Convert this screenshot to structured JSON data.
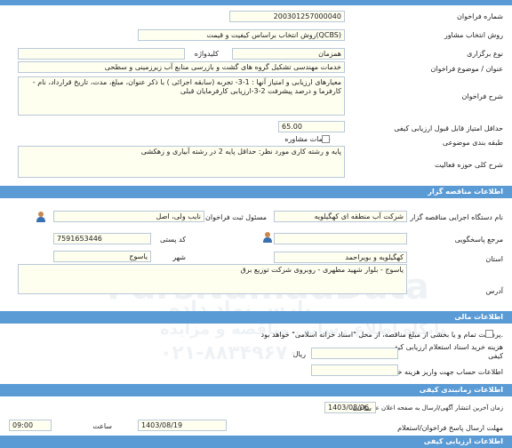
{
  "sections": {
    "tender": "",
    "organizer": "اطلاعات مناقصه گزار",
    "financial": "اطلاعات مالی",
    "timing": "اطلاعات زمانبندی کیفی",
    "quality": "اطلاعات ارزیابی کیفی"
  },
  "tender": {
    "number_label": "شماره فراخوان",
    "number": "200301257000040",
    "method_label": "روش انتخاب مشاور",
    "method": "روش انتخاب براساس کیفیت و قیمت(QCBS)",
    "type_label": "نوع برگزاری",
    "type": "همزمان",
    "keyword_label": "کلیدواژه",
    "keyword": "",
    "subject_label": "عنوان / موضوع فراخوان",
    "subject": "خدمات مهندسی تشکیل گروه های گشت و بازرسی منابع آب زیرزمینی و سطحی",
    "description_label": "شرح فراخوان",
    "description": "- معیارهای ارزیابی و امتیاز آنها : 1-3- تجربه (سابقه اجرائی ) با ذکر عنوان، مبلغ، مدت، تاریخ قرارداد، نام کارفرما و درصد پیشرفت 2-3-ارزیابی کارفرمایان قبلی",
    "min_score_label": "حداقل امتیاز قابل قبول ارزیابی کیفی",
    "min_score": "65.00",
    "category_label": "طبقه بندی موضوعی",
    "category_option": "خدمات مشاوره",
    "activity_label": "شرح کلی حوزه فعالیت",
    "activity": "پایه و رشته کاری مورد نظر: حداقل پایه 2 در رشته آبیاری و زهکشی"
  },
  "organizer": {
    "executor_label": "نام دستگاه اجرایی مناقصه گزار",
    "executor": "شرکت آب منطقه ای کهگیلویه",
    "registrar_label": "مسئول ثبت فراخوان",
    "registrar": "نایب ولی، اصل",
    "reference_label": "مرجع پاسخگویی",
    "reference": "",
    "postal_label": "کد پستی",
    "postal": "7591653446",
    "province_label": "استان",
    "province": "کهگیلویه و بویراحمد",
    "city_label": "شهر",
    "city": "یاسوج",
    "address_label": "آدرس",
    "address": "یاسوج - بلوار شهید مطهری - روبروی شرکت توزیع برق"
  },
  "financial": {
    "payment_label": "پرداخت تمام و یا بخشی از مبلغ مناقصه، از محل \"اسناد خزانه اسلامی\" خواهد بود.",
    "doc_fee_label": "هزینه خرید اسناد استعلام ارزیابی کیفی",
    "doc_fee": "",
    "currency": "ریال",
    "account_label": "اطلاعات حساب جهت واریز هزینه خرید",
    "account": ""
  },
  "timing": {
    "publish_label": "زمان آخرین انتشار آگهی/ارسال به صفحه اعلان عمومی",
    "publish_date": "1403/08/06",
    "publish_time_label": "ساعت",
    "publish_time": "",
    "deadline_label": "مهلت ارسال پاسخ فراخوان/استعلام",
    "deadline_date": "1403/08/19",
    "deadline_time_label": "ساعت",
    "deadline_time": "09:00"
  },
  "watermark": {
    "brand": "ParsNamadData",
    "tagline": "پارس نماد داده",
    "phone": "۰۲۱-۸۸۳۴۹۶۷۰",
    "tender_info": "پایگاه اطلاع رسانی مناقصه و مزایده"
  }
}
